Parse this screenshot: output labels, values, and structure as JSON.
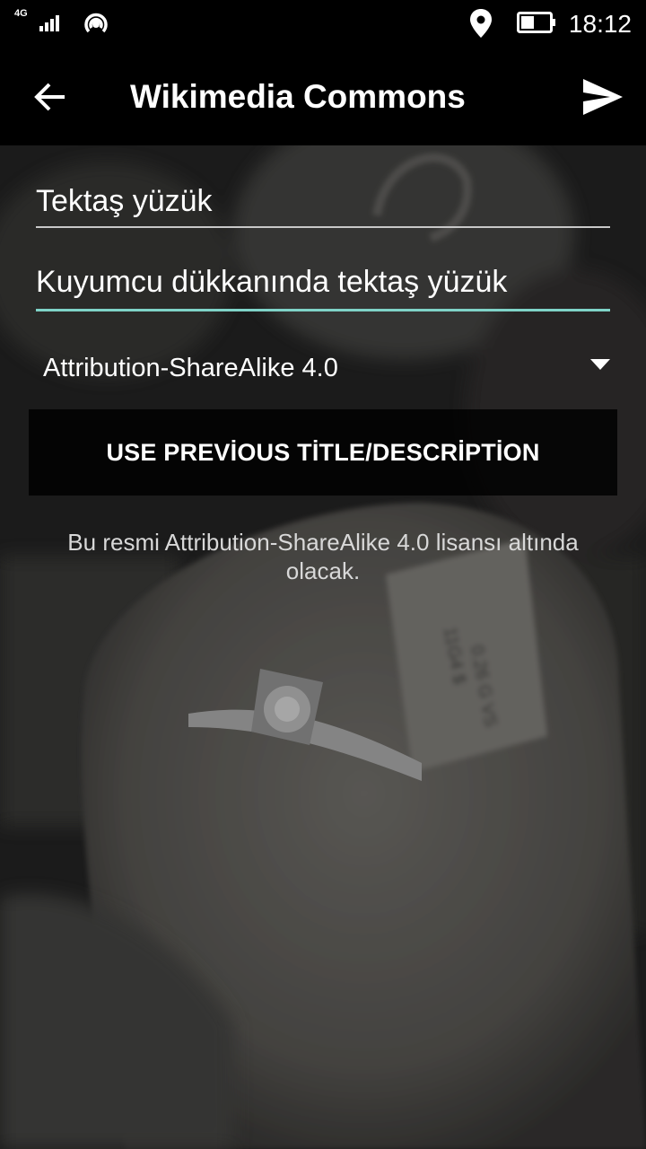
{
  "status_bar": {
    "network": "4G",
    "time": "18:12"
  },
  "toolbar": {
    "title": "Wikimedia Commons",
    "back_icon": "arrow-left-icon",
    "send_icon": "send-icon"
  },
  "form": {
    "title_value": "Tektaş yüzük",
    "description_value": "Kuyumcu dükkanında tektaş yüzük",
    "license_selected": "Attribution-ShareAlike 4.0",
    "use_previous_label": "USE PREVİOUS TİTLE/DESCRİPTİON",
    "license_note": "Bu resmi Attribution-ShareAlike 4.0 lisansı altında olacak."
  },
  "colors": {
    "accent": "#7fd3c8",
    "bars": "#000000"
  }
}
